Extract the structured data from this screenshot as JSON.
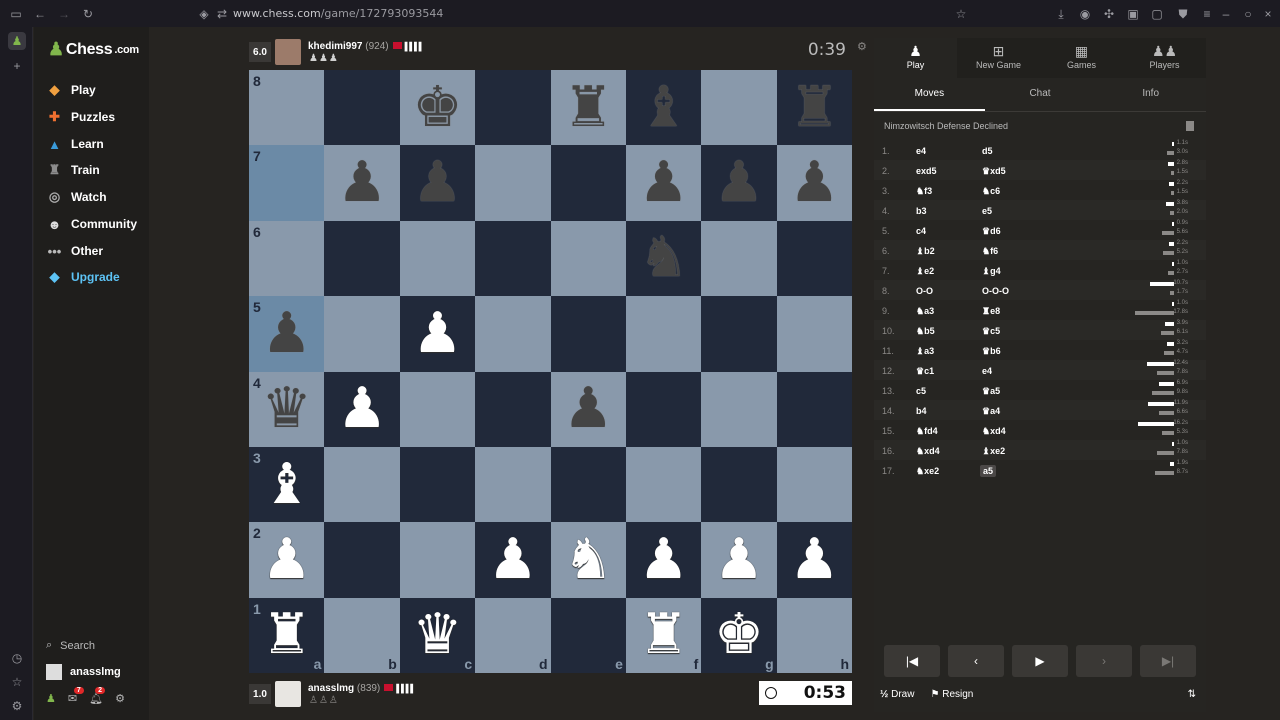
{
  "browser": {
    "url_domain": "www.chess.com",
    "url_path": "/game/172793093544"
  },
  "sidebar": {
    "logo": "Chess",
    "logo_suffix": ".com",
    "items": [
      {
        "label": "Play",
        "icon": "play-icon",
        "color": "#ffffff"
      },
      {
        "label": "Puzzles",
        "icon": "puzzle-icon",
        "color": "#ffffff"
      },
      {
        "label": "Learn",
        "icon": "learn-icon",
        "color": "#ffffff"
      },
      {
        "label": "Train",
        "icon": "train-icon",
        "color": "#ffffff"
      },
      {
        "label": "Watch",
        "icon": "watch-icon",
        "color": "#ffffff"
      },
      {
        "label": "Community",
        "icon": "community-icon",
        "color": "#ffffff"
      },
      {
        "label": "Other",
        "icon": "more-icon",
        "color": "#ffffff"
      },
      {
        "label": "Upgrade",
        "icon": "diamond-icon",
        "color": "#5dc3f5"
      }
    ],
    "search_label": "Search",
    "username": "anasslmg",
    "mail_badge": "7",
    "notif_badge": "2"
  },
  "top_player": {
    "eval": "6.0",
    "name": "khedimi997",
    "rating": "(924)",
    "captured": "♟♟♟",
    "clock": "0:39"
  },
  "bottom_player": {
    "eval": "1.0",
    "name": "anasslmg",
    "rating": "(839)",
    "captured": "♙♙♙",
    "clock": "0:53"
  },
  "board": {
    "files": [
      "a",
      "b",
      "c",
      "d",
      "e",
      "f",
      "g",
      "h"
    ],
    "ranks": [
      "8",
      "7",
      "6",
      "5",
      "4",
      "3",
      "2",
      "1"
    ],
    "rows": [
      [
        "",
        "",
        "bK",
        "",
        "bR",
        "bB",
        "",
        "bR"
      ],
      [
        "",
        "bP",
        "bP",
        "",
        "",
        "bP",
        "bP",
        "bP"
      ],
      [
        "",
        "",
        "",
        "",
        "",
        "bN",
        "",
        ""
      ],
      [
        "bP",
        "",
        "wP",
        "",
        "",
        "",
        "",
        ""
      ],
      [
        "bQ",
        "wP",
        "",
        "",
        "bP",
        "",
        "",
        ""
      ],
      [
        "wB",
        "",
        "",
        "",
        "",
        "",
        "",
        ""
      ],
      [
        "wP",
        "",
        "",
        "wP",
        "wN",
        "wP",
        "wP",
        "wP"
      ],
      [
        "wR",
        "",
        "wQ",
        "",
        "",
        "wR",
        "wK",
        ""
      ]
    ]
  },
  "panel": {
    "tabs": [
      {
        "label": "Play",
        "icon": "play-pawn-icon"
      },
      {
        "label": "New Game",
        "icon": "plus-icon"
      },
      {
        "label": "Games",
        "icon": "board-icon"
      },
      {
        "label": "Players",
        "icon": "players-icon"
      }
    ],
    "subtabs": [
      "Moves",
      "Chat",
      "Info"
    ],
    "opening": "Nimzowitsch Defense Declined",
    "moves": [
      {
        "n": "1.",
        "w": "e4",
        "b": "d5",
        "tw": "1.1s",
        "tb": "3.0s"
      },
      {
        "n": "2.",
        "w": "exd5",
        "b": "♛xd5",
        "tw": "2.8s",
        "tb": "1.5s"
      },
      {
        "n": "3.",
        "w": "♞f3",
        "b": "♞c6",
        "tw": "2.2s",
        "tb": "1.5s"
      },
      {
        "n": "4.",
        "w": "b3",
        "b": "e5",
        "tw": "3.8s",
        "tb": "2.0s"
      },
      {
        "n": "5.",
        "w": "c4",
        "b": "♛d6",
        "tw": "0.9s",
        "tb": "5.6s"
      },
      {
        "n": "6.",
        "w": "♝b2",
        "b": "♞f6",
        "tw": "2.2s",
        "tb": "5.2s"
      },
      {
        "n": "7.",
        "w": "♝e2",
        "b": "♝g4",
        "tw": "1.0s",
        "tb": "2.7s"
      },
      {
        "n": "8.",
        "w": "O-O",
        "b": "O-O-O",
        "tw": "10.7s",
        "tb": "1.7s"
      },
      {
        "n": "9.",
        "w": "♞a3",
        "b": "♜e8",
        "tw": "1.0s",
        "tb": "17.8s"
      },
      {
        "n": "10.",
        "w": "♞b5",
        "b": "♛c5",
        "tw": "3.9s",
        "tb": "6.1s"
      },
      {
        "n": "11.",
        "w": "♝a3",
        "b": "♛b6",
        "tw": "3.2s",
        "tb": "4.7s"
      },
      {
        "n": "12.",
        "w": "♛c1",
        "b": "e4",
        "tw": "12.4s",
        "tb": "7.8s"
      },
      {
        "n": "13.",
        "w": "c5",
        "b": "♛a5",
        "tw": "6.9s",
        "tb": "9.8s"
      },
      {
        "n": "14.",
        "w": "b4",
        "b": "♛a4",
        "tw": "11.9s",
        "tb": "6.6s"
      },
      {
        "n": "15.",
        "w": "♞fd4",
        "b": "♞xd4",
        "tw": "16.2s",
        "tb": "5.3s"
      },
      {
        "n": "16.",
        "w": "♞xd4",
        "b": "♝xe2",
        "tw": "1.0s",
        "tb": "7.8s"
      },
      {
        "n": "17.",
        "w": "♞xe2",
        "b": "a5",
        "tw": "1.9s",
        "tb": "8.7s"
      }
    ],
    "draw_label": "Draw",
    "draw_prefix": "½",
    "resign_label": "Resign"
  }
}
